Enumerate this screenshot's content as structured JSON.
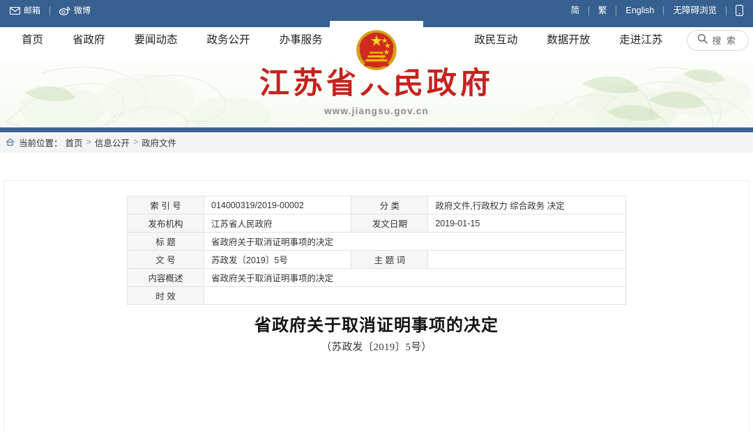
{
  "topbar": {
    "left": [
      {
        "icon": "mail-icon",
        "label": "邮箱"
      },
      {
        "icon": "weibo-icon",
        "label": "微博"
      }
    ],
    "right": [
      {
        "label": "简"
      },
      {
        "label": "繁"
      },
      {
        "label": "English"
      },
      {
        "label": "无障碍浏览"
      }
    ],
    "phone_icon": "mobile-phone-icon",
    "background_color": "#36608f"
  },
  "nav": {
    "left_items": [
      "首页",
      "省政府",
      "要闻动态",
      "政务公开",
      "办事服务"
    ],
    "right_items": [
      "政民互动",
      "数据开放",
      "走进江苏"
    ],
    "search": {
      "icon": "search-icon",
      "label": "搜 索"
    },
    "emblem": "national-emblem-of-china"
  },
  "banner": {
    "title": "江苏省人民政府",
    "url": "www.jiangsu.gov.cn",
    "title_color": "#c4221f",
    "rule_color": "#3a6496"
  },
  "breadcrumb": {
    "home_icon": "home-icon",
    "label": "当前位置：",
    "items": [
      "首页",
      "信息公开",
      "政府文件"
    ],
    "separator": ">"
  },
  "meta_table": {
    "rows": [
      {
        "label1": "索 引 号",
        "value1": "014000319/2019-00002",
        "label2": "分    类",
        "value2": "政府文件,行政权力 综合政务 决定"
      },
      {
        "label1": "发布机构",
        "value1": "江苏省人民政府",
        "label2": "发文日期",
        "value2": "2019-01-15"
      },
      {
        "label1": "标    题",
        "value1": "省政府关于取消证明事项的决定"
      },
      {
        "label1": "文    号",
        "value1": "苏政发〔2019〕5号",
        "label2": "主 题 词",
        "value2": ""
      },
      {
        "label1": "内容概述",
        "value1": "省政府关于取消证明事项的决定"
      },
      {
        "label1": "时    效",
        "value1": ""
      }
    ]
  },
  "document": {
    "title": "省政府关于取消证明事项的决定",
    "subtitle": "（苏政发〔2019〕5号）"
  }
}
